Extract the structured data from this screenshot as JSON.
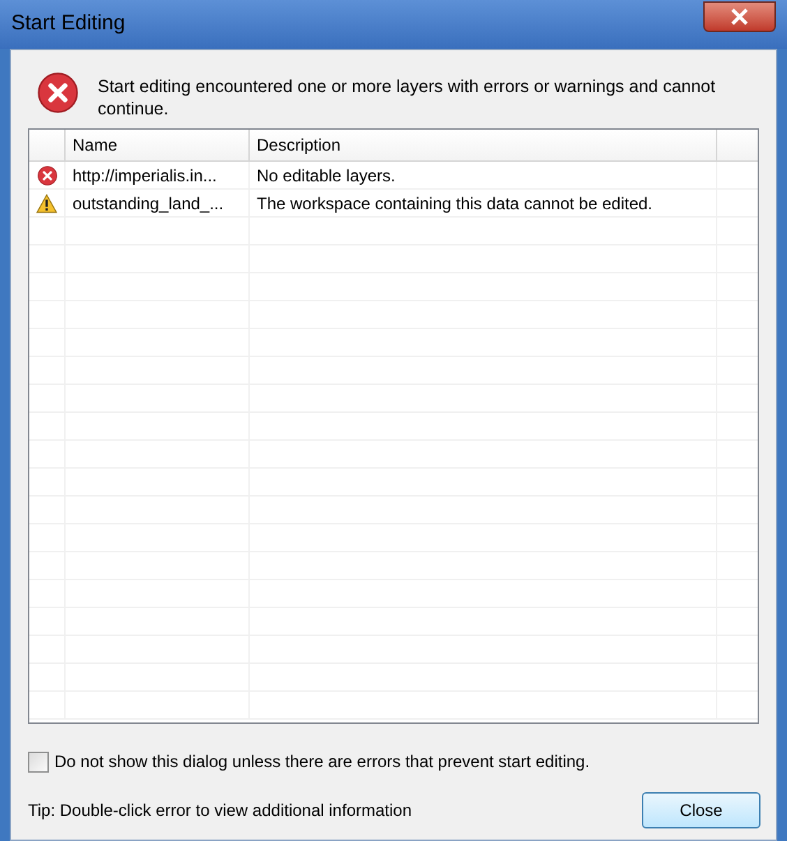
{
  "window": {
    "title": "Start Editing"
  },
  "message": "Start editing encountered one or more layers with errors or warnings and cannot continue.",
  "table": {
    "columns": [
      "Name",
      "Description"
    ],
    "rows": [
      {
        "kind": "error",
        "name": "http://imperialis.in...",
        "description": "No editable layers."
      },
      {
        "kind": "warning",
        "name": "outstanding_land_...",
        "description": "The workspace containing this data cannot be edited."
      }
    ]
  },
  "option": {
    "label": "Do not show this dialog unless there are errors that prevent start editing.",
    "checked": false
  },
  "tip": "Tip: Double-click error to view additional information",
  "buttons": [
    "Close"
  ]
}
